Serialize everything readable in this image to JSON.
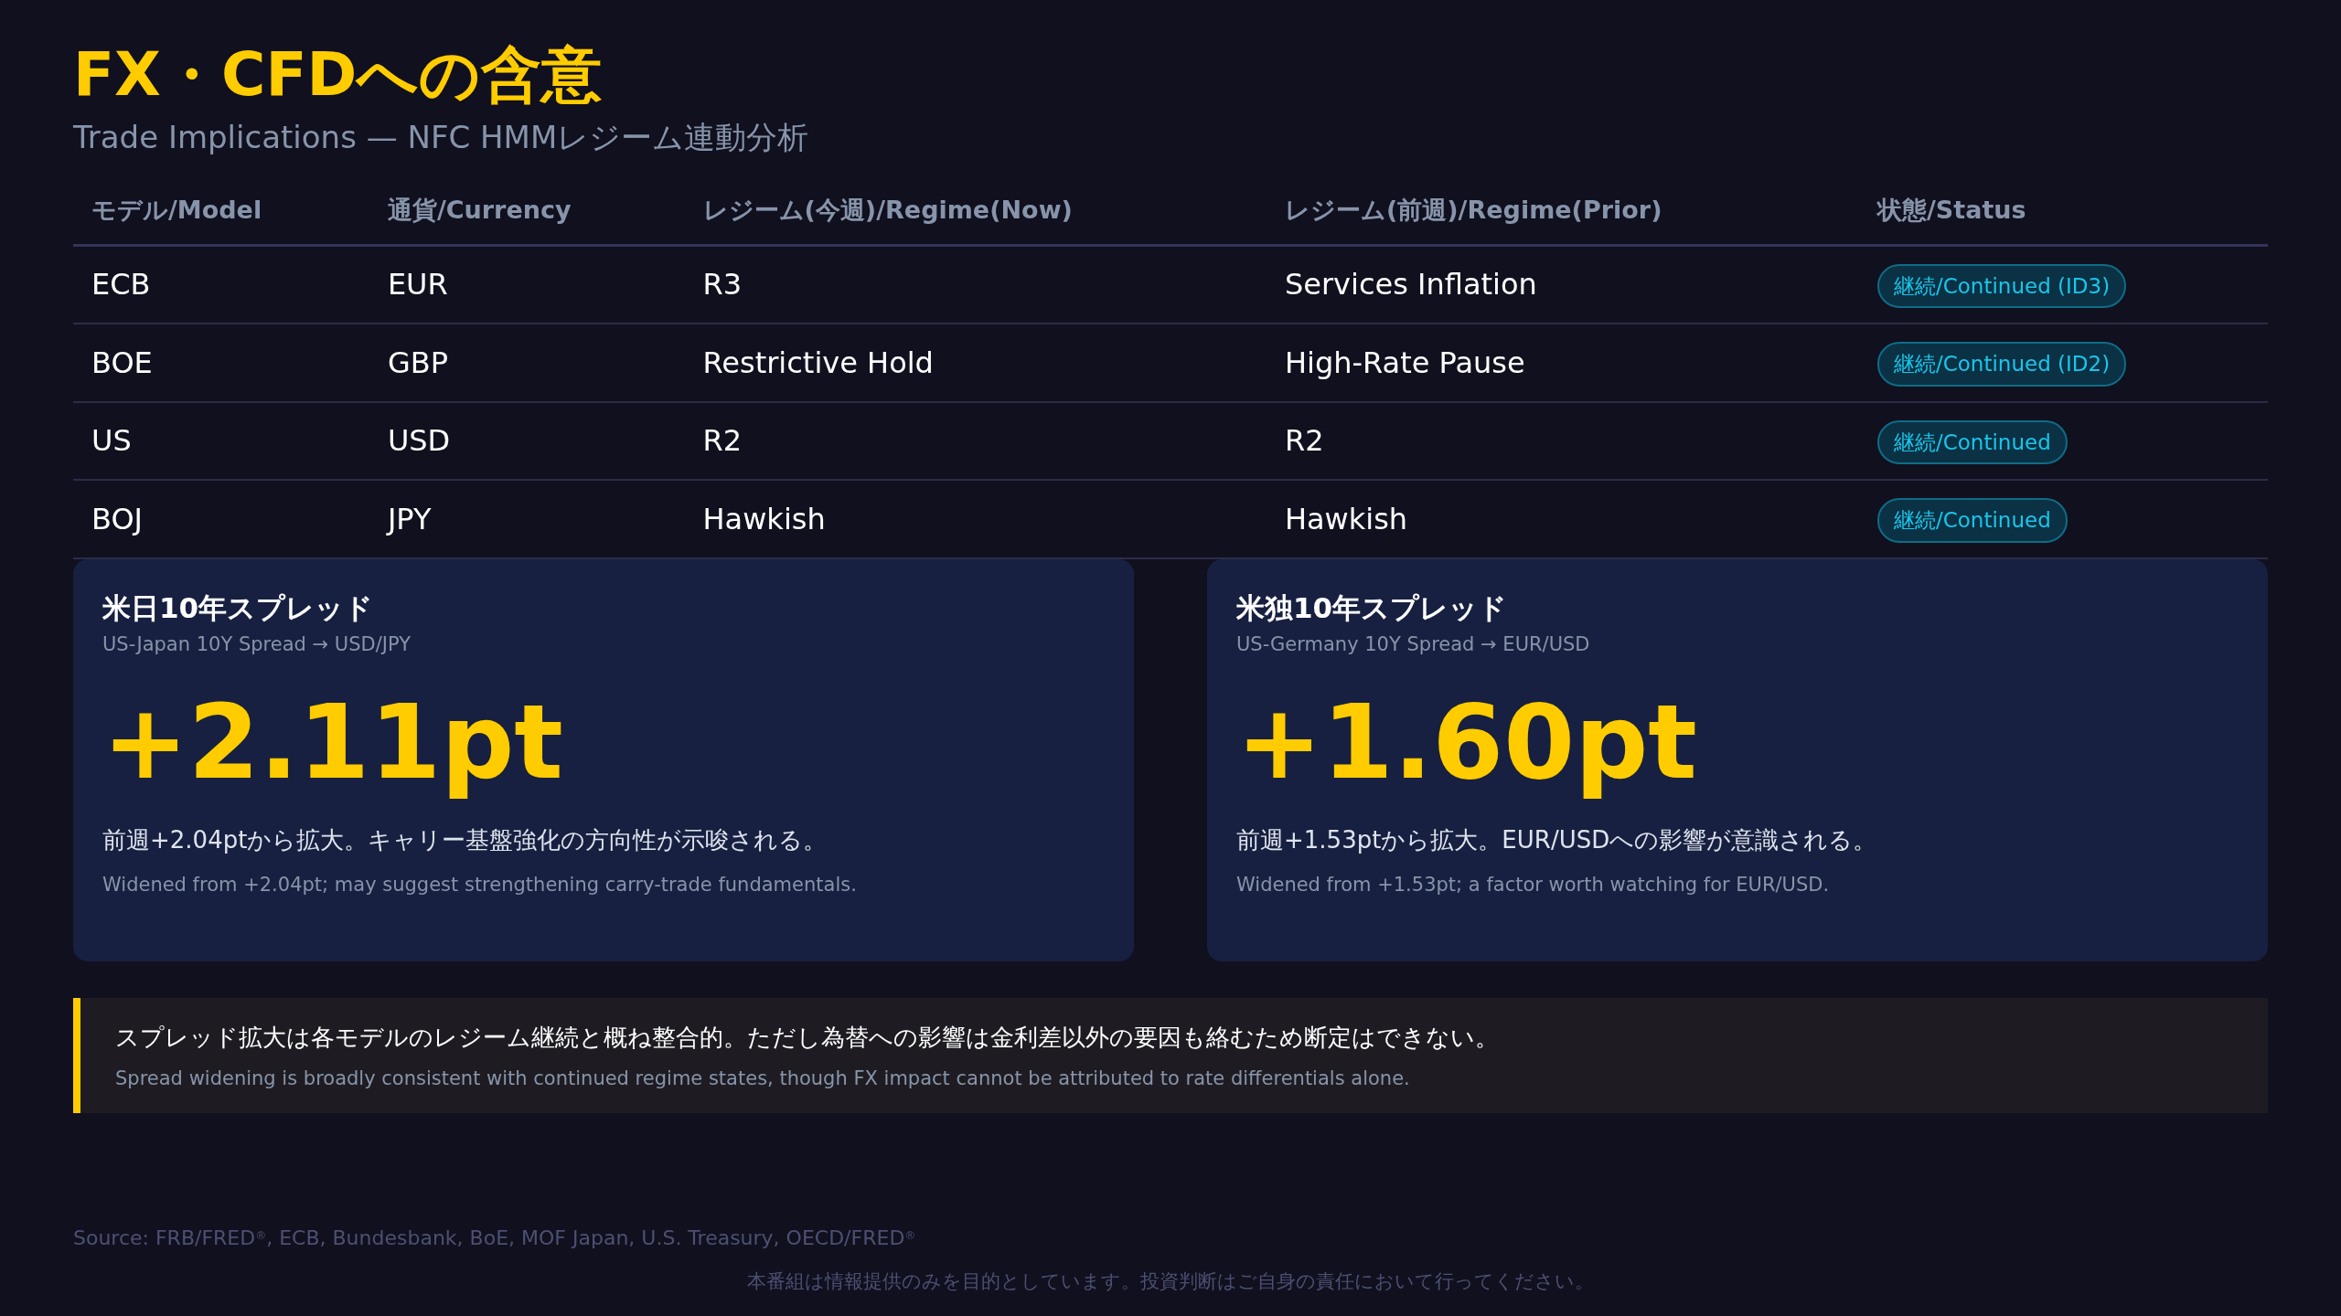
{
  "title": "FX・CFDへの含意",
  "subtitle": "Trade Implications — NFC HMMレジーム連動分析",
  "table": {
    "columns": [
      "モデル/Model",
      "通貨/Currency",
      "レジーム(今週)/Regime(Now)",
      "レジーム(前週)/Regime(Prior)",
      "状態/Status"
    ],
    "rows": [
      {
        "model": "ECB",
        "currency": "EUR",
        "regime_now": "R3",
        "regime_prior": "Services Inflation",
        "status": "継続/Continued (ID3)"
      },
      {
        "model": "BOE",
        "currency": "GBP",
        "regime_now": "Restrictive Hold",
        "regime_prior": "High-Rate Pause",
        "status": "継続/Continued (ID2)"
      },
      {
        "model": "US",
        "currency": "USD",
        "regime_now": "R2",
        "regime_prior": "R2",
        "status": "継続/Continued"
      },
      {
        "model": "BOJ",
        "currency": "JPY",
        "regime_now": "Hawkish",
        "regime_prior": "Hawkish",
        "status": "継続/Continued"
      }
    ]
  },
  "cards": [
    {
      "title": "米日10年スプレッド",
      "subtitle": "US-Japan 10Y Spread → USD/JPY",
      "value": "+2.11pt",
      "text_ja": "前週+2.04ptから拡大。キャリー基盤強化の方向性が示唆される。",
      "text_en": "Widened from +2.04pt; may suggest strengthening carry-trade fundamentals."
    },
    {
      "title": "米独10年スプレッド",
      "subtitle": "US-Germany 10Y Spread → EUR/USD",
      "value": "+1.60pt",
      "text_ja": "前週+1.53ptから拡大。EUR/USDへの影響が意識される。",
      "text_en": "Widened from +1.53pt; a factor worth watching for EUR/USD."
    }
  ],
  "note": {
    "text_ja": "スプレッド拡大は各モデルのレジーム継続と概ね整合的。ただし為替への影響は金利差以外の要因も絡むため断定はできない。",
    "text_en": "Spread widening is broadly consistent with continued regime states, though FX impact cannot be attributed to rate differentials alone."
  },
  "source": "Source: FRB/FRED$^{®}$, ECB, Bundesbank, BoE, MOF Japan, U.S. Treasury, OECD/FRED$^{®}$",
  "disclaimer": "本番組は情報提供のみを目的としています。投資判断はご自身の責任において行ってください。"
}
